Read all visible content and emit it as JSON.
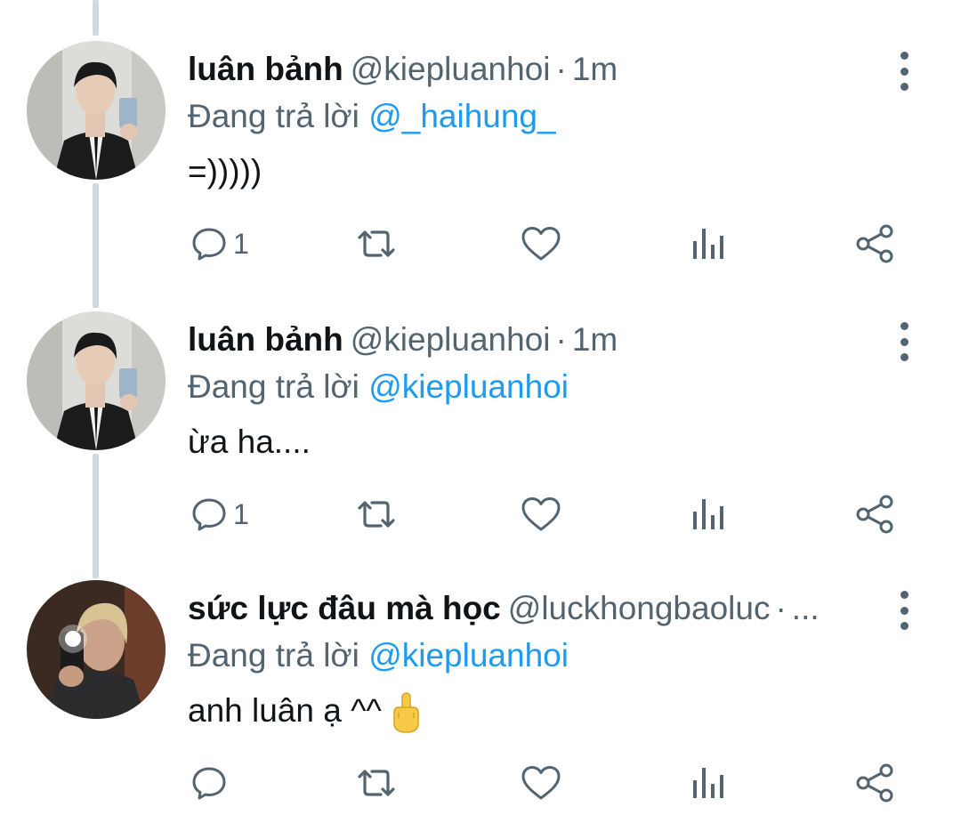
{
  "tweets": [
    {
      "name": "luân bảnh",
      "handle": "@kiepluanhoi",
      "separator": "·",
      "time": "1m",
      "reply_prefix": "Đang trả lời",
      "reply_to": "@_haihung_",
      "text": "=)))))",
      "reply_count": "1",
      "avatar": "mirror-selfie-black-suit"
    },
    {
      "name": "luân bảnh",
      "handle": "@kiepluanhoi",
      "separator": "·",
      "time": "1m",
      "reply_prefix": "Đang trả lời",
      "reply_to": "@kiepluanhoi",
      "text": "ừa ha....",
      "reply_count": "1",
      "avatar": "mirror-selfie-black-suit"
    },
    {
      "name": "sức lực đâu mà học",
      "handle": "@luckhongbaoluc",
      "separator": "·",
      "time": "...",
      "reply_prefix": "Đang trả lời",
      "reply_to": "@kiepluanhoi",
      "text": "anh luân ạ ^^",
      "text_emoji": "middle-finger-emoji",
      "reply_count": "",
      "avatar": "phone-flash-selfie"
    }
  ],
  "icons": {
    "more": "more-vertical-icon",
    "reply": "reply-icon",
    "retweet": "retweet-icon",
    "like": "heart-icon",
    "views": "analytics-icon",
    "share": "share-icon"
  },
  "colors": {
    "link": "#1d9bf0",
    "secondary_text": "#536471",
    "thread_line": "#cfd9de"
  }
}
